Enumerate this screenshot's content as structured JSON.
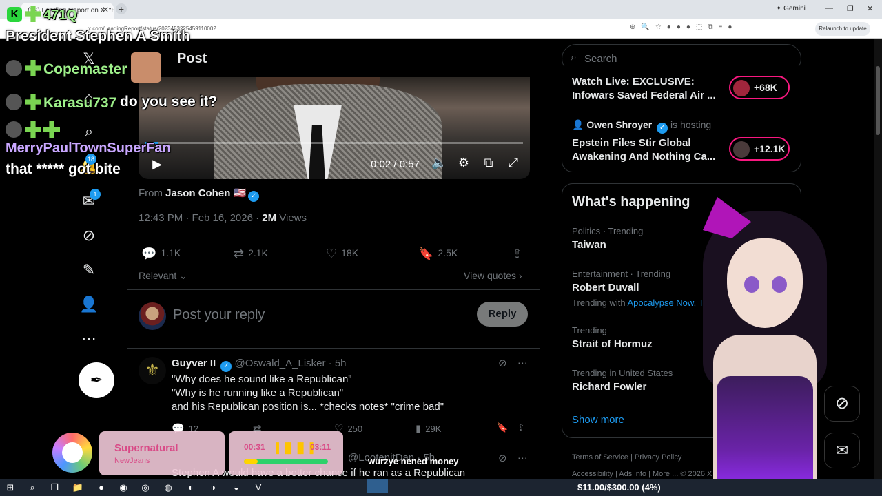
{
  "browser": {
    "tab_title": "(19) Leading Report on X: \"BRE",
    "gemini_label": "Gemini",
    "url": "x.com/LeadingReport/status/2023453225459110002",
    "relaunch_label": "Relaunch to update"
  },
  "nav": {
    "notifications_badge": "18",
    "messages_badge": "1"
  },
  "post": {
    "header": "Post",
    "video_time": "0:02 / 0:57",
    "video_progress": 0.035,
    "from_label": "From",
    "from_name": "Jason Cohen 🇺🇸",
    "timestamp": "12:43 PM · Feb 16, 2026 ·",
    "views_count": "2M",
    "views_label": "Views",
    "replies": "1.1K",
    "reposts": "2.1K",
    "likes": "18K",
    "bookmarks": "2.5K",
    "relevant_label": "Relevant",
    "view_quotes_label": "View quotes",
    "reply_placeholder": "Post your reply",
    "reply_button": "Reply"
  },
  "tweet1": {
    "name": "Guyver II",
    "handle": "@Oswald_A_Lisker · 5h",
    "line1": "\"Why does he sound like a Republican\"",
    "line2": "\"Why is he running like a Republican\"",
    "line3": "and his Republican position is... *checks notes* \"crime bad\"",
    "replies": "12",
    "likes": "250",
    "views": "29K"
  },
  "tweet2": {
    "handle": "@LootenitDan · 5h",
    "line1": "Stephen A would have a better chance if he ran as a Republican"
  },
  "right": {
    "search_placeholder": "Search",
    "live1_title": "Watch Live: EXCLUSIVE: Infowars Saved Federal Air ...",
    "live1_count": "+68K",
    "host_name": "Owen Shroyer",
    "host_suffix": "is hosting",
    "live2_title": "Epstein Files Stir Global Awakening And Nothing Ca...",
    "live2_count": "+12.1K",
    "whats_happening": "What's happening",
    "trends": [
      {
        "category": "Politics · Trending",
        "name": "Taiwan"
      },
      {
        "category": "Entertainment · Trending",
        "name": "Robert Duvall"
      },
      {
        "category": "Trending",
        "name": "Strait of Hormuz"
      },
      {
        "category": "Trending in United States",
        "name": "Richard Fowler"
      }
    ],
    "trending_with_label": "Trending with",
    "trending_with_link": "Apocalypse Now, Ti",
    "show_more": "Show more",
    "footer1": "Terms of Service  |  Privacy Policy",
    "footer2": "Accessibility  |  Ads info  |  More ...  © 2026 X Corp."
  },
  "overlay": {
    "chat_count": "471Q",
    "chat_title": "President Stephen A Smith",
    "user1": "Copemaster",
    "user2": "Karasu737",
    "msg2": "do you see it?",
    "user3": "MerryPaulTownSuperFan",
    "msg3": "that ***** got bite",
    "subtitle": "wurzye nened money"
  },
  "music": {
    "song": "Supernatural",
    "artist": "NewJeans",
    "elapsed": "00:31",
    "total": "03:11",
    "progress": 0.16
  },
  "goal": {
    "text": "$11.00/$300.00 (4%)",
    "progress": 0.04
  }
}
